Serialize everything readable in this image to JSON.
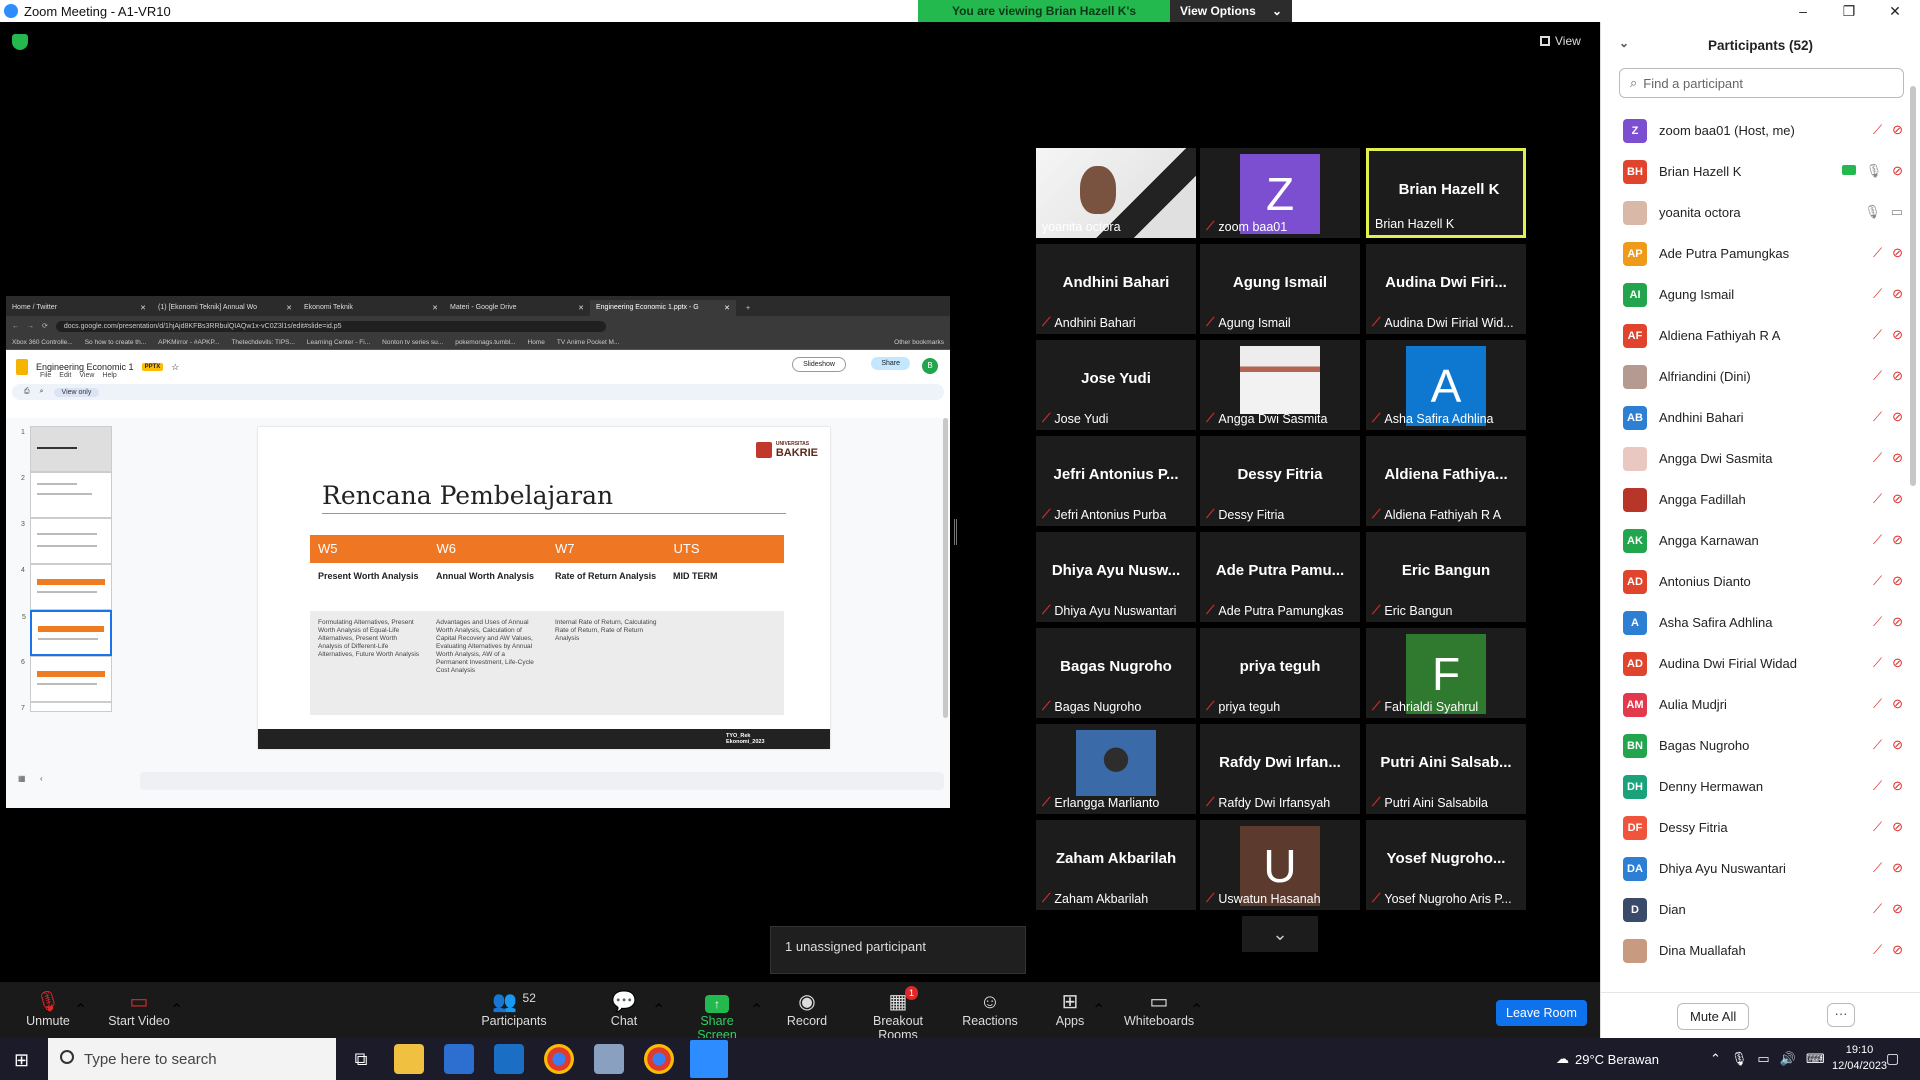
{
  "window": {
    "title": "Zoom Meeting - A1-VR10",
    "viewing_banner": "You are viewing Brian Hazell K's screen",
    "view_options": "View Options",
    "view_label": "View",
    "min": "–",
    "max": "❐",
    "close": "✕"
  },
  "browser": {
    "tabs": [
      "Home / Twitter",
      "(1) [Ekonomi Teknik] Annual Wo",
      "Ekonomi Teknik",
      "Materi - Google Drive",
      "Engineering Economic 1.pptx - G"
    ],
    "url": "docs.google.com/presentation/d/1hjAjd8KFBs3RRbulQIAQw1x-vC0Z3l1s/edit#slide=id.p5",
    "bookmarks": [
      "Xbox 360 Controlle...",
      "So how to create th...",
      "APKMirror - #APKP...",
      "Thetechdevils: TIPS...",
      "Learning Center - Fi...",
      "Nonton tv series su...",
      "pokemonags.tumbl...",
      "Home",
      "TV Anime Pocket M...",
      "Other bookmarks"
    ],
    "doc_title": "Engineering Economic 1",
    "doc_badge": "PPTX",
    "menu": [
      "File",
      "Edit",
      "View",
      "Help"
    ],
    "slideshow": "Slideshow",
    "share": "Share",
    "account_initial": "B",
    "view_only": "View only"
  },
  "slide": {
    "logo_small": "UNIVERSITAS",
    "logo": "BAKRIE",
    "title": "Rencana Pembelajaran",
    "weeks": [
      "W5",
      "W6",
      "W7",
      "UTS"
    ],
    "topics": [
      "Present Worth Analysis",
      "Annual Worth Analysis",
      "Rate of Return Analysis",
      "MID TERM"
    ],
    "descriptions": [
      "Formulating Alternatives, Present Worth Analysis of Equal-Life Alternatives, Present Worth Analysis of Different-Life Alternatives, Future Worth Analysis",
      "Advantages and Uses of Annual Worth Analysis, Calculation of Capital Recovery and AW Values, Evaluating Alternatives by Annual Worth Analysis, AW of a Permanent Investment, Life-Cycle Cost Analysis",
      "Internal Rate of Return, Calculating Rate of Return, Rate of Return Analysis",
      ""
    ],
    "footer": "TYO_Rek Ekonomi_2023",
    "thumb_numbers": [
      "1",
      "2",
      "3",
      "4",
      "5",
      "6",
      "7"
    ]
  },
  "gallery": [
    {
      "big": "",
      "name": "yoanita octora",
      "muted": false,
      "kind": "video-woman"
    },
    {
      "big": "",
      "name": "zoom baa01",
      "muted": true,
      "kind": "letter",
      "letter": "Z",
      "color": "#7b4fd0"
    },
    {
      "big": "Brian Hazell K",
      "name": "Brian Hazell K",
      "muted": false,
      "kind": "active"
    },
    {
      "big": "Andhini Bahari",
      "name": "Andhini Bahari",
      "muted": true
    },
    {
      "big": "Agung Ismail",
      "name": "Agung Ismail",
      "muted": true
    },
    {
      "big": "Audina Dwi Firi...",
      "name": "Audina Dwi Firial Wid...",
      "muted": true
    },
    {
      "big": "Jose Yudi",
      "name": "Jose Yudi",
      "muted": true
    },
    {
      "big": "",
      "name": "Angga Dwi Sasmita",
      "muted": true,
      "kind": "photo-slide"
    },
    {
      "big": "",
      "name": "Asha Safira Adhlina",
      "muted": true,
      "kind": "letter",
      "letter": "A",
      "color": "#0e78d0"
    },
    {
      "big": "Jefri Antonius P...",
      "name": "Jefri Antonius Purba",
      "muted": true
    },
    {
      "big": "Dessy Fitria",
      "name": "Dessy Fitria",
      "muted": true
    },
    {
      "big": "Aldiena Fathiya...",
      "name": "Aldiena Fathiyah R A",
      "muted": true
    },
    {
      "big": "Dhiya Ayu Nusw...",
      "name": "Dhiya Ayu Nuswantari",
      "muted": true
    },
    {
      "big": "Ade Putra Pamu...",
      "name": "Ade Putra Pamungkas",
      "muted": true
    },
    {
      "big": "Eric Bangun",
      "name": "Eric Bangun",
      "muted": true
    },
    {
      "big": "Bagas Nugroho",
      "name": "Bagas Nugroho",
      "muted": true
    },
    {
      "big": "priya teguh",
      "name": "priya teguh",
      "muted": true
    },
    {
      "big": "",
      "name": "Fahrialdi Syahrul",
      "muted": true,
      "kind": "letter",
      "letter": "F",
      "color": "#2f7a2f"
    },
    {
      "big": "",
      "name": "Erlangga Marlianto",
      "muted": true,
      "kind": "photo-boy"
    },
    {
      "big": "Rafdy Dwi Irfan...",
      "name": "Rafdy Dwi Irfansyah",
      "muted": true
    },
    {
      "big": "Putri Aini Salsab...",
      "name": "Putri Aini Salsabila",
      "muted": true
    },
    {
      "big": "Zaham Akbarilah",
      "name": "Zaham Akbarilah",
      "muted": true
    },
    {
      "big": "",
      "name": "Uswatun Hasanah",
      "muted": true,
      "kind": "letter",
      "letter": "U",
      "color": "#5c3b2e"
    },
    {
      "big": "Yosef Nugroho...",
      "name": "Yosef Nugroho Aris P...",
      "muted": true
    }
  ],
  "unassigned": "1 unassigned participant",
  "toolbar": {
    "unmute": "Unmute",
    "start_video": "Start Video",
    "participants": "Participants",
    "participants_count": "52",
    "chat": "Chat",
    "share_screen": "Share Screen",
    "record": "Record",
    "breakout": "Breakout Rooms",
    "breakout_badge": "1",
    "reactions": "Reactions",
    "apps": "Apps",
    "whiteboards": "Whiteboards",
    "leave": "Leave Room"
  },
  "panel": {
    "title": "Participants (52)",
    "find_placeholder": "Find a participant",
    "mute_all": "Mute All",
    "more": "···",
    "participants": [
      {
        "initials": "Z",
        "name": "zoom baa01 (Host, me)",
        "color": "#7b4fd0",
        "state": "muted"
      },
      {
        "initials": "BH",
        "name": "Brian Hazell K",
        "color": "#e0442c",
        "state": "sharing"
      },
      {
        "initials": "",
        "name": "yoanita octora",
        "color": "#d9b8a8",
        "state": "ok"
      },
      {
        "initials": "AP",
        "name": "Ade Putra Pamungkas",
        "color": "#f09a1a",
        "state": "muted"
      },
      {
        "initials": "AI",
        "name": "Agung Ismail",
        "color": "#23a54d",
        "state": "muted"
      },
      {
        "initials": "AF",
        "name": "Aldiena Fathiyah R A",
        "color": "#e0442c",
        "state": "muted"
      },
      {
        "initials": "",
        "name": "Alfriandini (Dini)",
        "color": "#b49a90",
        "state": "muted"
      },
      {
        "initials": "AB",
        "name": "Andhini Bahari",
        "color": "#2d7fd3",
        "state": "muted"
      },
      {
        "initials": "",
        "name": "Angga Dwi Sasmita",
        "color": "#e8c8c0",
        "state": "muted"
      },
      {
        "initials": "",
        "name": "Angga Fadillah",
        "color": "#b8352a",
        "state": "muted"
      },
      {
        "initials": "AK",
        "name": "Angga Karnawan",
        "color": "#23a54d",
        "state": "muted"
      },
      {
        "initials": "AD",
        "name": "Antonius Dianto",
        "color": "#e0442c",
        "state": "muted"
      },
      {
        "initials": "A",
        "name": "Asha Safira Adhlina",
        "color": "#2d7fd3",
        "state": "muted"
      },
      {
        "initials": "AD",
        "name": "Audina Dwi Firial Widad",
        "color": "#e0442c",
        "state": "muted"
      },
      {
        "initials": "AM",
        "name": "Aulia Mudjri",
        "color": "#e03a4c",
        "state": "muted"
      },
      {
        "initials": "BN",
        "name": "Bagas Nugroho",
        "color": "#23a54d",
        "state": "muted"
      },
      {
        "initials": "DH",
        "name": "Denny Hermawan",
        "color": "#1aa37a",
        "state": "muted"
      },
      {
        "initials": "DF",
        "name": "Dessy Fitria",
        "color": "#f0543c",
        "state": "muted"
      },
      {
        "initials": "DA",
        "name": "Dhiya Ayu Nuswantari",
        "color": "#2d7fd3",
        "state": "muted"
      },
      {
        "initials": "D",
        "name": "Dian",
        "color": "#3a4a6a",
        "state": "muted"
      },
      {
        "initials": "",
        "name": "Dina Muallafah",
        "color": "#c89a80",
        "state": "muted"
      }
    ]
  },
  "taskbar": {
    "search_placeholder": "Type here to search",
    "weather": "29°C Berawan",
    "time": "19:10",
    "date": "12/04/2023"
  }
}
